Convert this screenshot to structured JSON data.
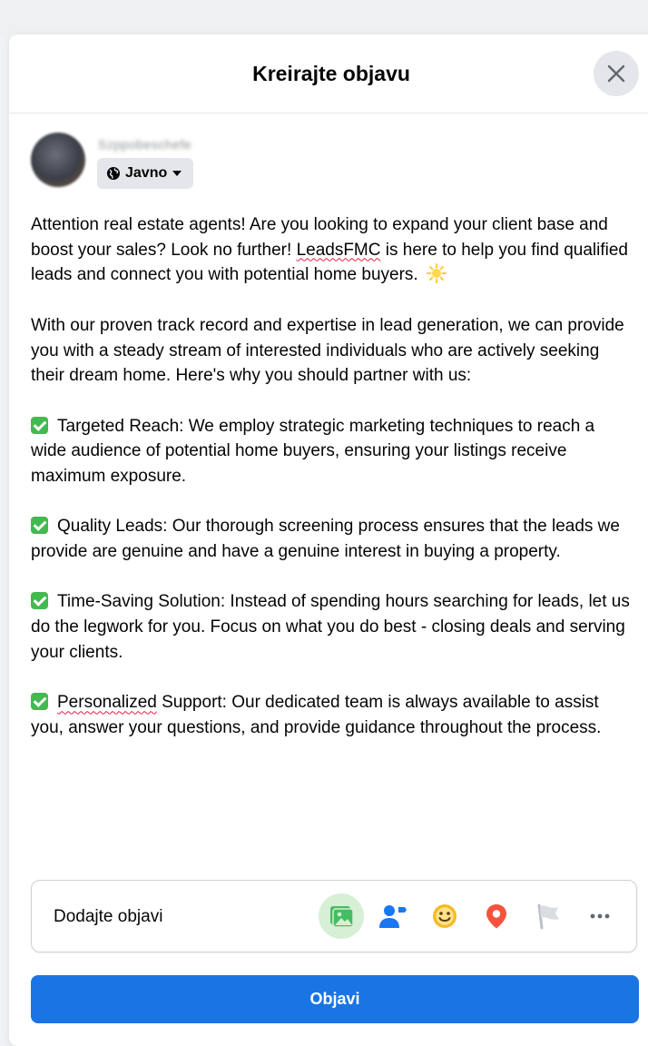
{
  "dialog": {
    "title": "Kreirajte objavu",
    "close_icon": "close-icon"
  },
  "author": {
    "name": "Szppobeschefe",
    "privacy_label": "Javno",
    "privacy_icon": "globe-icon",
    "dropdown_icon": "caret-down-icon"
  },
  "post": {
    "intro_a": "Attention real estate agents! Are you looking to expand your client base and boost your sales? Look no further! ",
    "brand": "LeadsFMC",
    "intro_b": " is here to help you find qualified leads and connect you with potential home buyers.",
    "para2": "With our proven track record and expertise in lead generation, we can provide you with a steady stream of interested individuals who are actively seeking their dream home. Here's why you should partner with us:",
    "bullet1": "Targeted Reach: We employ strategic marketing techniques to reach a wide audience of potential home buyers, ensuring your listings receive maximum exposure.",
    "bullet2": "Quality Leads: Our thorough screening process ensures that the leads we provide are genuine and have a genuine interest in buying a property.",
    "bullet3": "Time-Saving Solution: Instead of spending hours searching for leads, let us do the legwork for you. Focus on what you do best - closing deals and serving your clients.",
    "bullet4_word": "Personalized",
    "bullet4_rest": " Support: Our dedicated team is always available to assist you, answer your questions, and provide guidance throughout the process."
  },
  "add_panel": {
    "label": "Dodajte objavi",
    "tools": [
      "photo-video-icon",
      "tag-people-icon",
      "feeling-icon",
      "check-in-icon",
      "flag-icon",
      "more-icon"
    ]
  },
  "colors": {
    "primary": "#1b74e4",
    "photo_bg": "#d6efd5",
    "check": "#43b94f",
    "location": "#f5533d",
    "feeling": "#f7b928"
  },
  "publish_label": "Objavi"
}
